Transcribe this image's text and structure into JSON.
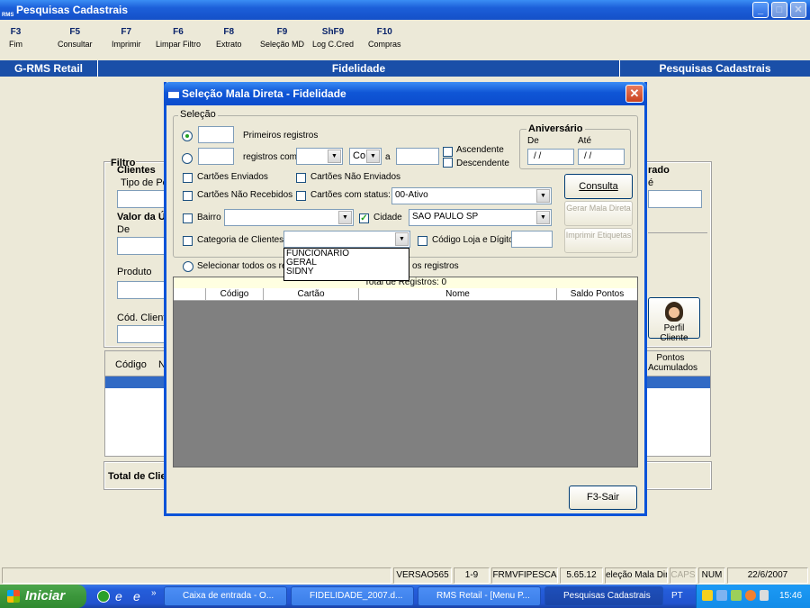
{
  "window": {
    "title": "Pesquisas Cadastrais",
    "logo": "RMS"
  },
  "fkeys": [
    {
      "key": "F3",
      "label": "Fim"
    },
    {
      "key": "F5",
      "label": "Consultar"
    },
    {
      "key": "F7",
      "label": "Imprimir"
    },
    {
      "key": "F6",
      "label": "Limpar Filtro"
    },
    {
      "key": "F8",
      "label": "Extrato"
    },
    {
      "key": "F9",
      "label": "Seleção MD"
    },
    {
      "key": "ShF9",
      "label": "Log C.Cred"
    },
    {
      "key": "F10",
      "label": "Compras"
    }
  ],
  "strip": {
    "left": "G-RMS Retail",
    "center": "Fidelidade",
    "right": "Pesquisas Cadastrais"
  },
  "background": {
    "filtro": "Filtro",
    "clientes": "Clientes",
    "tipo_pessoa": "Tipo de Pes",
    "valor": "Valor da Ú",
    "de": "De",
    "produto": "Produto",
    "cod_cliente": "Cód. Cliente",
    "rado": "rado",
    "ate": "é",
    "perfil": "Perfil Cliente",
    "col_codigo": "Código",
    "col_n": "N",
    "col_pontos": "Pontos Acumulados",
    "total": "Total de Clie"
  },
  "dialog": {
    "title": "Seleção Mala Direta - Fidelidade",
    "selecao": "Seleção",
    "primeiros": "Primeiros registros",
    "registros_com": "registros com",
    "op_value": "Co",
    "a": "a",
    "ascendente": "Ascendente",
    "descendente": "Descendente",
    "aniversario": "Aniversário",
    "de": "De",
    "ate": "Até",
    "date_de": "/ /",
    "date_ate": "/ /",
    "cartoes_enviados": "Cartões Enviados",
    "cartoes_nao_enviados": "Cartões Não Enviados",
    "cartoes_nao_recebidos": "Cartões Não Recebidos",
    "cartoes_status": "Cartões com status:",
    "status_value": "00-Ativo",
    "bairro": "Bairro",
    "cidade": "Cidade",
    "cidade_value": "SAO PAULO SP",
    "categoria": "Categoria de Clientes",
    "codigo_loja": "Código Loja e Dígito",
    "categoria_options": [
      "FUNCIONARIO",
      "GERAL",
      "SIDNY"
    ],
    "selecionar_todos": "Selecionar todos os reg",
    "os_registros": "os registros",
    "total_registros": "Total de Registros: 0",
    "col_codigo": "Código",
    "col_cartao": "Cartão",
    "col_nome": "Nome",
    "col_saldo": "Saldo Pontos",
    "btn_consulta": "Consulta",
    "btn_gerar": "Gerar Mala Direta",
    "btn_imprimir": "Imprimir Etiquetas",
    "btn_sair": "F3-Sair"
  },
  "status": {
    "versao": "VERSAO565",
    "page": "1-9",
    "form": "FRMVFIPESCA",
    "ver": "5.65.12",
    "title": "eleção Mala Dire",
    "caps": "CAPS",
    "num": "NUM",
    "date": "22/6/2007"
  },
  "taskbar": {
    "start": "Iniciar",
    "tasks": [
      "Caixa de entrada - O...",
      "FIDELIDADE_2007.d...",
      "RMS Retail - [Menu P...",
      "Pesquisas Cadastrais"
    ],
    "lang": "PT",
    "time": "15:46"
  }
}
